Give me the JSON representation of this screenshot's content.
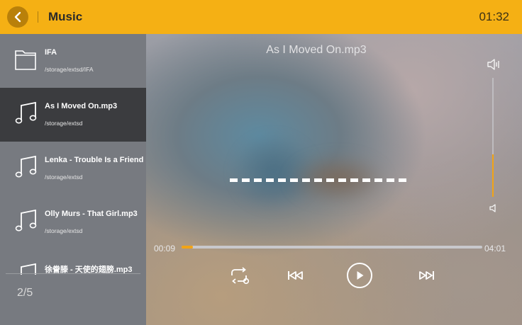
{
  "header": {
    "title": "Music",
    "time": "01:32"
  },
  "sidebar": {
    "items": [
      {
        "type": "folder",
        "icon": "folder-icon",
        "title": "IFA",
        "path": "/storage/extsd/IFA"
      },
      {
        "type": "song",
        "icon": "music-note-icon",
        "title": "As I Moved On.mp3",
        "path": "/storage/extsd",
        "selected": true
      },
      {
        "type": "song",
        "icon": "music-note-icon",
        "title": "Lenka - Trouble Is a Friend [",
        "path": "/storage/extsd"
      },
      {
        "type": "song",
        "icon": "music-note-icon",
        "title": "Olly Murs - That Girl.mp3",
        "path": "/storage/extsd"
      },
      {
        "type": "song",
        "icon": "music-note-icon",
        "title": "徐誊滕 - 天使的翅膀.mp3",
        "path": ""
      }
    ],
    "page_indicator": "2/5"
  },
  "player": {
    "track_title": "As I Moved On.mp3",
    "current_time": "00:09",
    "total_time": "04:01",
    "progress_fraction": 0.037,
    "volume_fraction": 0.36,
    "accent_color": "#f2a415"
  },
  "colors": {
    "header_bg": "#f5b014",
    "sidebar_bg": "#777a80",
    "selected_bg": "#3b3c3f"
  }
}
